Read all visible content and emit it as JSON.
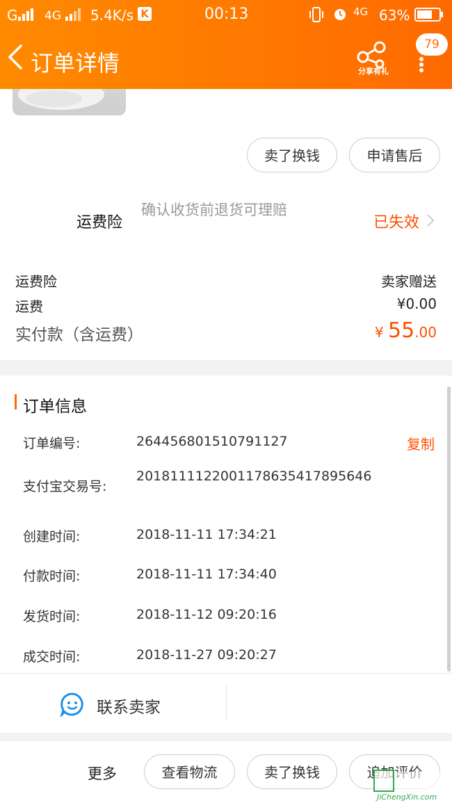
{
  "status_bar": {
    "carrier": "G",
    "network": "4G",
    "speed": "5.4K/s",
    "time": "00:13",
    "network2": "4G",
    "battery": "63%"
  },
  "header": {
    "title": "订单详情",
    "share_label": "分享有礼",
    "badge_count": "79",
    "accent_color": "#ff6a00"
  },
  "actions": {
    "sell_label": "卖了换钱",
    "after_sale_label": "申请售后"
  },
  "insurance": {
    "label": "运费险",
    "description": "确认收货前退货可理赔",
    "status": "已失效"
  },
  "costs": {
    "rows": [
      {
        "label": "运费险",
        "value": "卖家赠送"
      },
      {
        "label": "运费",
        "value": "¥0.00"
      }
    ],
    "total_label": "实付款（含运费）",
    "total_currency": "¥",
    "total_int": "55",
    "total_dec": ".00"
  },
  "order_info": {
    "title": "订单信息",
    "copy_label": "复制",
    "rows": [
      {
        "key": "订单编号:",
        "value": "264456801510791127"
      },
      {
        "key": "支付宝交易号:",
        "value": "2018111122001178635417895646"
      },
      {
        "key": "创建时间:",
        "value": "2018-11-11 17:34:21"
      },
      {
        "key": "付款时间:",
        "value": "2018-11-11 17:34:40"
      },
      {
        "key": "发货时间:",
        "value": "2018-11-12 09:20:16"
      },
      {
        "key": "成交时间:",
        "value": "2018-11-27 09:20:27"
      }
    ],
    "contact_label": "联系卖家"
  },
  "bottom_bar": {
    "more_label": "更多",
    "logistics_label": "查看物流",
    "sell_label": "卖了换钱",
    "review_label": "追加评价"
  },
  "watermark": {
    "text": "JiChengXin.com"
  }
}
